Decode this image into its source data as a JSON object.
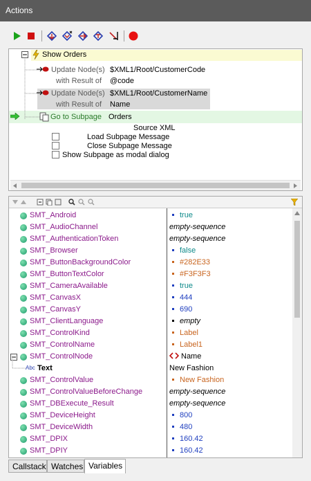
{
  "window": {
    "title": "Actions"
  },
  "toolbar": {
    "icons": [
      "run-icon",
      "stop-icon",
      "step-into-icon",
      "step-out-icon",
      "step-over-icon",
      "step-next-icon",
      "skip-icon",
      "breakpoint-icon"
    ]
  },
  "actions_tree": {
    "root_label": "Show Orders",
    "items": [
      {
        "label": "Update Node(s)",
        "value": "$XML1/Root/CustomerCode",
        "result_label": "with Result of",
        "result_value": "@code"
      },
      {
        "label": "Update Node(s)",
        "value": "$XML1/Root/CustomerName",
        "result_label": "with Result of",
        "result_value": "Name"
      }
    ],
    "subpage": {
      "label": "Go to Subpage",
      "value": "Orders",
      "source": "Source XML",
      "options": [
        "Load Subpage Message",
        "Close Subpage Message",
        "Show Subpage as modal dialog"
      ]
    }
  },
  "variables": [
    {
      "name": "SMT_Android",
      "value": "true",
      "style": "teal",
      "marker": true
    },
    {
      "name": "SMT_AudioChannel",
      "value": "empty-sequence",
      "style": "italic",
      "marker": false
    },
    {
      "name": "SMT_AuthenticationToken",
      "value": "empty-sequence",
      "style": "italic",
      "marker": false
    },
    {
      "name": "SMT_Browser",
      "value": "false",
      "style": "teal",
      "marker": true
    },
    {
      "name": "SMT_ButtonBackgroundColor",
      "value": "#282E33",
      "style": "orange",
      "marker": true
    },
    {
      "name": "SMT_ButtonTextColor",
      "value": "#F3F3F3",
      "style": "orange",
      "marker": true
    },
    {
      "name": "SMT_CameraAvailable",
      "value": "true",
      "style": "teal",
      "marker": true
    },
    {
      "name": "SMT_CanvasX",
      "value": "444",
      "style": "blue",
      "marker": true
    },
    {
      "name": "SMT_CanvasY",
      "value": "690",
      "style": "blue",
      "marker": true
    },
    {
      "name": "SMT_ClientLanguage",
      "value": "empty",
      "style": "italic",
      "marker": true
    },
    {
      "name": "SMT_ControlKind",
      "value": "Label",
      "style": "orange",
      "marker": true
    },
    {
      "name": "SMT_ControlName",
      "value": "Label1",
      "style": "orange",
      "marker": true
    },
    {
      "name": "SMT_ControlNode",
      "value": "Name",
      "style": "node",
      "marker": false
    },
    {
      "name": "Text",
      "value": "New Fashion",
      "style": "text-node",
      "marker": false
    },
    {
      "name": "SMT_ControlValue",
      "value": "New Fashion",
      "style": "orange",
      "marker": true
    },
    {
      "name": "SMT_ControlValueBeforeChange",
      "value": "empty-sequence",
      "style": "italic",
      "marker": false
    },
    {
      "name": "SMT_DBExecute_Result",
      "value": "empty-sequence",
      "style": "italic",
      "marker": false
    },
    {
      "name": "SMT_DeviceHeight",
      "value": "800",
      "style": "blue",
      "marker": true
    },
    {
      "name": "SMT_DeviceWidth",
      "value": "480",
      "style": "blue",
      "marker": true
    },
    {
      "name": "SMT_DPIX",
      "value": "160.42",
      "style": "blue",
      "marker": true
    },
    {
      "name": "SMT_DPIY",
      "value": "160.42",
      "style": "blue",
      "marker": true
    }
  ],
  "text_node_prefix": "Abc",
  "tabs": [
    "Callstack",
    "Watches",
    "Variables"
  ],
  "active_tab": "Variables"
}
